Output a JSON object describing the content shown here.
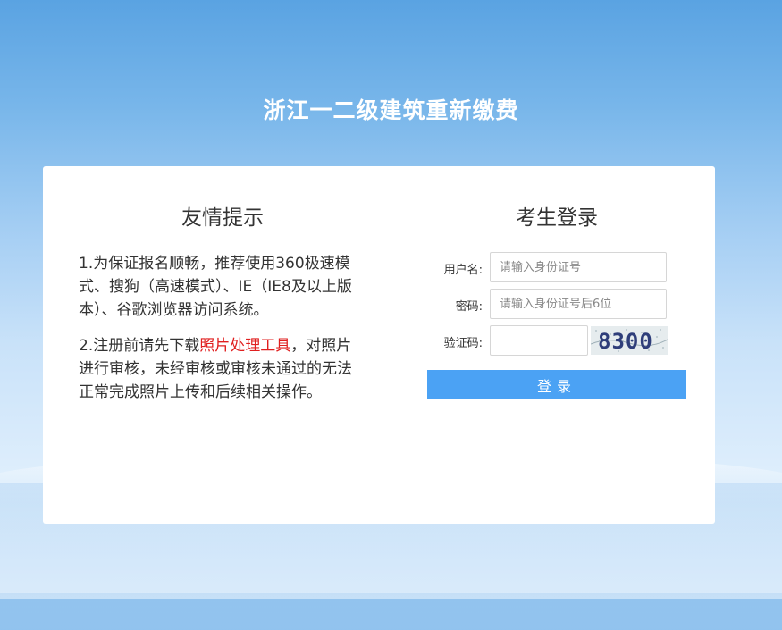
{
  "page": {
    "title": "浙江一二级建筑重新缴费"
  },
  "tips": {
    "title": "友情提示",
    "item1": "1.为保证报名顺畅，推荐使用360极速模式、搜狗（高速模式）、IE（IE8及以上版本）、谷歌浏览器访问系统。",
    "item2_before": "2.注册前请先下载",
    "item2_link": "照片处理工具",
    "item2_after": "，对照片进行审核，未经审核或审核未通过的无法正常完成照片上传和后续相关操作。"
  },
  "login": {
    "title": "考生登录",
    "username_label": "用户名:",
    "username_placeholder": "请输入身份证号",
    "password_label": "密码:",
    "password_placeholder": "请输入身份证号后6位",
    "captcha_label": "验证码:",
    "captcha_text": "8300",
    "button_label": "登录"
  },
  "colors": {
    "accent": "#4ba2f4",
    "link": "#e02020",
    "title": "#ffffff"
  }
}
